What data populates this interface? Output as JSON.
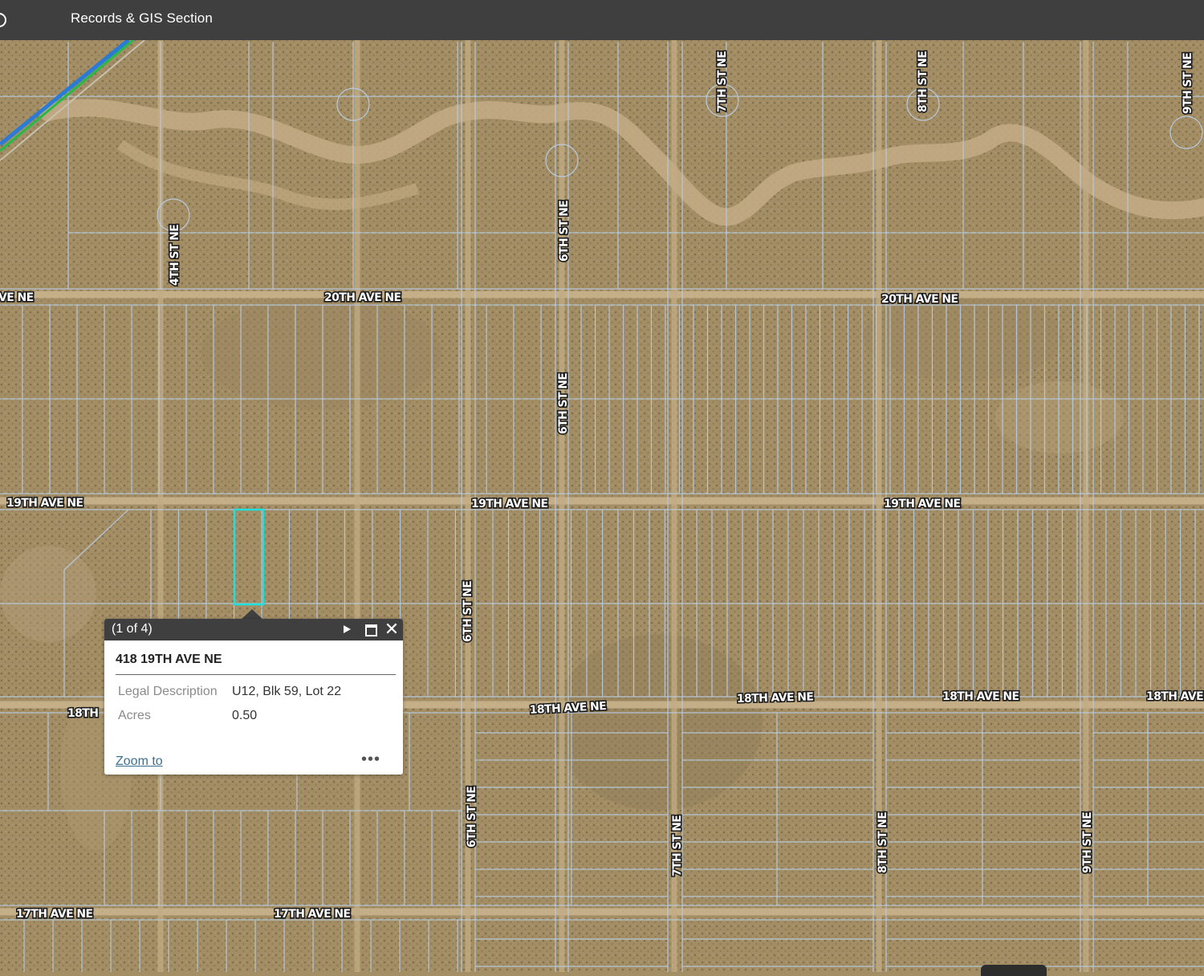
{
  "app": {
    "title": "Records & GIS Section"
  },
  "map": {
    "basemap": "satellite-imagery",
    "parcel_line_color": "#b8cadb",
    "selected_parcel_color": "#1fe0dc",
    "street_labels": [
      {
        "text": "20TH AVE NE"
      },
      {
        "text": "20TH AVE NE"
      },
      {
        "text": "VE NE"
      },
      {
        "text": "19TH AVE NE"
      },
      {
        "text": "19TH AVE NE"
      },
      {
        "text": "19TH AVE NE"
      },
      {
        "text": "18TH AVE NE"
      },
      {
        "text": "18TH AVE NE"
      },
      {
        "text": "18TH AVE NE"
      },
      {
        "text": "18TH AVE"
      },
      {
        "text": "18TH"
      },
      {
        "text": "17TH AVE NE"
      },
      {
        "text": "17TH AVE NE"
      },
      {
        "text": "4TH ST NE"
      },
      {
        "text": "6TH ST NE"
      },
      {
        "text": "6TH ST NE"
      },
      {
        "text": "6TH ST NE"
      },
      {
        "text": "6TH ST NE"
      },
      {
        "text": "7TH ST NE"
      },
      {
        "text": "7TH ST NE"
      },
      {
        "text": "8TH ST NE"
      },
      {
        "text": "8TH ST NE"
      },
      {
        "text": "9TH ST NE"
      },
      {
        "text": "9TH ST NE"
      }
    ]
  },
  "popup": {
    "count": "(1 of 4)",
    "title": "418 19TH AVE NE",
    "fields": [
      {
        "label": "Legal Description",
        "value": "U12, Blk 59, Lot 22"
      },
      {
        "label": "Acres",
        "value": "0.50"
      }
    ],
    "zoom_label": "Zoom to",
    "more_label": "•••",
    "close_label": "✕"
  },
  "colors": {
    "header_bg": "#3f3f3f",
    "link": "#3a6f8f"
  }
}
